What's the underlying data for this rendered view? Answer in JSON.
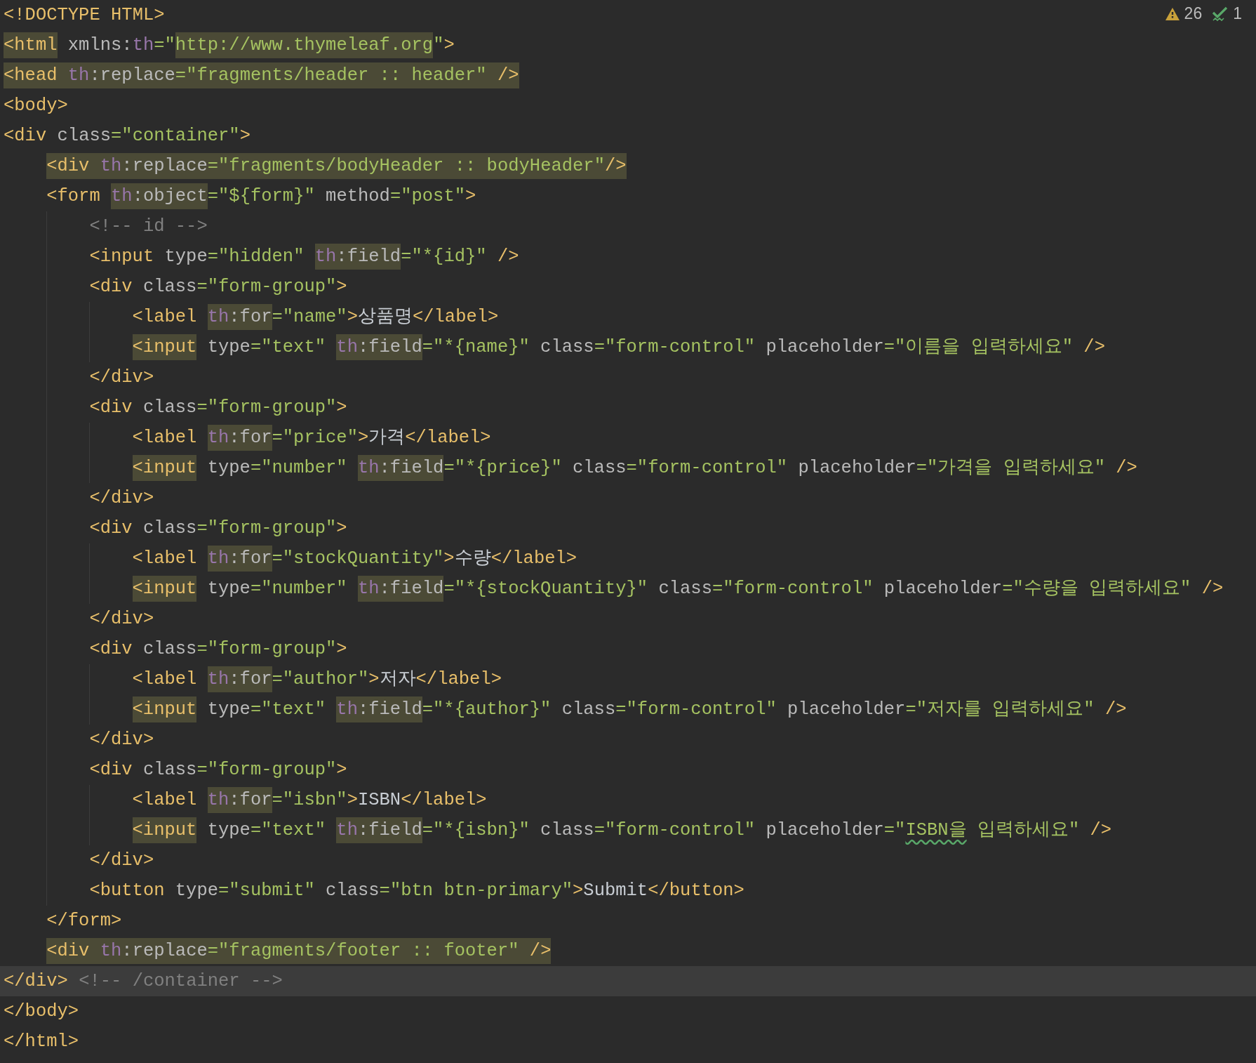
{
  "inspections": {
    "warnings": "26",
    "passed": "1"
  },
  "lines": [
    {
      "current": false,
      "segments": [
        {
          "text": "<!DOCTYPE HTML>",
          "kind": "tag",
          "highlighted": false
        }
      ]
    },
    {
      "current": false,
      "segments": [
        {
          "text": "<html",
          "kind": "tag",
          "highlighted": true
        },
        {
          "text": " xmlns:",
          "kind": "attribute",
          "highlighted": false
        },
        {
          "text": "th",
          "kind": "namespace",
          "highlighted": false
        },
        {
          "text": "=\"",
          "kind": "value",
          "highlighted": false
        },
        {
          "text": "http://www.thymeleaf.org",
          "kind": "value",
          "highlighted": true
        },
        {
          "text": "\"",
          "kind": "value",
          "highlighted": false
        },
        {
          "text": ">",
          "kind": "tag",
          "highlighted": false
        }
      ]
    },
    {
      "current": false,
      "segments": [
        {
          "text": "<head",
          "kind": "tag",
          "highlighted": true
        },
        {
          "text": " th",
          "kind": "namespace",
          "highlighted": true
        },
        {
          "text": ":replace",
          "kind": "attribute",
          "highlighted": true
        },
        {
          "text": "=\"fragments/header :: header\"",
          "kind": "value",
          "highlighted": true
        },
        {
          "text": " />",
          "kind": "tag",
          "highlighted": true
        }
      ]
    },
    {
      "current": false,
      "segments": [
        {
          "text": "<body>",
          "kind": "tag",
          "highlighted": false
        }
      ]
    },
    {
      "current": false,
      "segments": [
        {
          "text": "<div",
          "kind": "tag",
          "highlighted": false
        },
        {
          "text": " class",
          "kind": "attribute",
          "highlighted": false
        },
        {
          "text": "=\"container\"",
          "kind": "value",
          "highlighted": false
        },
        {
          "text": ">",
          "kind": "tag",
          "highlighted": false
        }
      ],
      "children": [
        {
          "current": false,
          "segments": [
            {
              "text": "<div",
              "kind": "tag",
              "highlighted": true
            },
            {
              "text": " th",
              "kind": "namespace",
              "highlighted": true
            },
            {
              "text": ":replace",
              "kind": "attribute",
              "highlighted": true
            },
            {
              "text": "=\"fragments/bodyHeader :: bodyHeader\"",
              "kind": "value",
              "highlighted": true
            },
            {
              "text": "/>",
              "kind": "tag",
              "highlighted": true
            }
          ]
        },
        {
          "current": false,
          "segments": [
            {
              "text": "<form ",
              "kind": "tag",
              "highlighted": false
            },
            {
              "text": "th",
              "kind": "namespace",
              "highlighted": true
            },
            {
              "text": ":object",
              "kind": "attribute",
              "highlighted": true
            },
            {
              "text": "=\"${form}\"",
              "kind": "value",
              "highlighted": false
            },
            {
              "text": " method",
              "kind": "attribute",
              "highlighted": false
            },
            {
              "text": "=\"post\"",
              "kind": "value",
              "highlighted": false
            },
            {
              "text": ">",
              "kind": "tag",
              "highlighted": false
            }
          ],
          "children": [
            {
              "current": false,
              "segments": [
                {
                  "text": "<!-- id -->",
                  "kind": "comment",
                  "highlighted": false
                }
              ]
            },
            {
              "current": false,
              "segments": [
                {
                  "text": "<input",
                  "kind": "tag",
                  "highlighted": false
                },
                {
                  "text": " type",
                  "kind": "attribute",
                  "highlighted": false
                },
                {
                  "text": "=\"hidden\" ",
                  "kind": "value",
                  "highlighted": false
                },
                {
                  "text": "th",
                  "kind": "namespace",
                  "highlighted": true
                },
                {
                  "text": ":field",
                  "kind": "attribute",
                  "highlighted": true
                },
                {
                  "text": "=\"*{id}\"",
                  "kind": "value",
                  "highlighted": false
                },
                {
                  "text": " />",
                  "kind": "tag",
                  "highlighted": false
                }
              ]
            },
            {
              "current": false,
              "segments": [
                {
                  "text": "<div",
                  "kind": "tag",
                  "highlighted": false
                },
                {
                  "text": " class",
                  "kind": "attribute",
                  "highlighted": false
                },
                {
                  "text": "=\"form-group\"",
                  "kind": "value",
                  "highlighted": false
                },
                {
                  "text": ">",
                  "kind": "tag",
                  "highlighted": false
                }
              ],
              "children": [
                {
                  "current": false,
                  "segments": [
                    {
                      "text": "<label ",
                      "kind": "tag",
                      "highlighted": false
                    },
                    {
                      "text": "th",
                      "kind": "namespace",
                      "highlighted": true
                    },
                    {
                      "text": ":for",
                      "kind": "attribute",
                      "highlighted": true
                    },
                    {
                      "text": "=\"name\"",
                      "kind": "value",
                      "highlighted": false
                    },
                    {
                      "text": ">",
                      "kind": "tag",
                      "highlighted": false
                    },
                    {
                      "text": "상품명",
                      "kind": "text",
                      "highlighted": false
                    },
                    {
                      "text": "</label>",
                      "kind": "tag",
                      "highlighted": false
                    }
                  ]
                },
                {
                  "current": false,
                  "segments": [
                    {
                      "text": "<input",
                      "kind": "tag",
                      "highlighted": true
                    },
                    {
                      "text": " type",
                      "kind": "attribute",
                      "highlighted": false
                    },
                    {
                      "text": "=\"text\" ",
                      "kind": "value",
                      "highlighted": false
                    },
                    {
                      "text": "th",
                      "kind": "namespace",
                      "highlighted": true
                    },
                    {
                      "text": ":field",
                      "kind": "attribute",
                      "highlighted": true
                    },
                    {
                      "text": "=\"*{name}\"",
                      "kind": "value",
                      "highlighted": false
                    },
                    {
                      "text": " class",
                      "kind": "attribute",
                      "highlighted": false
                    },
                    {
                      "text": "=\"form-control\"",
                      "kind": "value",
                      "highlighted": false
                    },
                    {
                      "text": " placeholder",
                      "kind": "attribute",
                      "highlighted": false
                    },
                    {
                      "text": "=\"이름을 입력하세요\"",
                      "kind": "value",
                      "highlighted": false
                    },
                    {
                      "text": " />",
                      "kind": "tag",
                      "highlighted": false
                    }
                  ]
                }
              ]
            },
            {
              "current": false,
              "segments": [
                {
                  "text": "</div>",
                  "kind": "tag",
                  "highlighted": false
                }
              ]
            },
            {
              "current": false,
              "segments": [
                {
                  "text": "<div",
                  "kind": "tag",
                  "highlighted": false
                },
                {
                  "text": " class",
                  "kind": "attribute",
                  "highlighted": false
                },
                {
                  "text": "=\"form-group\"",
                  "kind": "value",
                  "highlighted": false
                },
                {
                  "text": ">",
                  "kind": "tag",
                  "highlighted": false
                }
              ],
              "children": [
                {
                  "current": false,
                  "segments": [
                    {
                      "text": "<label ",
                      "kind": "tag",
                      "highlighted": false
                    },
                    {
                      "text": "th",
                      "kind": "namespace",
                      "highlighted": true
                    },
                    {
                      "text": ":for",
                      "kind": "attribute",
                      "highlighted": true
                    },
                    {
                      "text": "=\"price\"",
                      "kind": "value",
                      "highlighted": false
                    },
                    {
                      "text": ">",
                      "kind": "tag",
                      "highlighted": false
                    },
                    {
                      "text": "가격",
                      "kind": "text",
                      "highlighted": false
                    },
                    {
                      "text": "</label>",
                      "kind": "tag",
                      "highlighted": false
                    }
                  ]
                },
                {
                  "current": false,
                  "segments": [
                    {
                      "text": "<input",
                      "kind": "tag",
                      "highlighted": true
                    },
                    {
                      "text": " type",
                      "kind": "attribute",
                      "highlighted": false
                    },
                    {
                      "text": "=\"number\" ",
                      "kind": "value",
                      "highlighted": false
                    },
                    {
                      "text": "th",
                      "kind": "namespace",
                      "highlighted": true
                    },
                    {
                      "text": ":field",
                      "kind": "attribute",
                      "highlighted": true
                    },
                    {
                      "text": "=\"*{price}\"",
                      "kind": "value",
                      "highlighted": false
                    },
                    {
                      "text": " class",
                      "kind": "attribute",
                      "highlighted": false
                    },
                    {
                      "text": "=\"form-control\"",
                      "kind": "value",
                      "highlighted": false
                    },
                    {
                      "text": " placeholder",
                      "kind": "attribute",
                      "highlighted": false
                    },
                    {
                      "text": "=\"가격을 입력하세요\"",
                      "kind": "value",
                      "highlighted": false
                    },
                    {
                      "text": " />",
                      "kind": "tag",
                      "highlighted": false
                    }
                  ]
                }
              ]
            },
            {
              "current": false,
              "segments": [
                {
                  "text": "</div>",
                  "kind": "tag",
                  "highlighted": false
                }
              ]
            },
            {
              "current": false,
              "segments": [
                {
                  "text": "<div",
                  "kind": "tag",
                  "highlighted": false
                },
                {
                  "text": " class",
                  "kind": "attribute",
                  "highlighted": false
                },
                {
                  "text": "=\"form-group\"",
                  "kind": "value",
                  "highlighted": false
                },
                {
                  "text": ">",
                  "kind": "tag",
                  "highlighted": false
                }
              ],
              "children": [
                {
                  "current": false,
                  "segments": [
                    {
                      "text": "<label ",
                      "kind": "tag",
                      "highlighted": false
                    },
                    {
                      "text": "th",
                      "kind": "namespace",
                      "highlighted": true
                    },
                    {
                      "text": ":for",
                      "kind": "attribute",
                      "highlighted": true
                    },
                    {
                      "text": "=\"stockQuantity\"",
                      "kind": "value",
                      "highlighted": false
                    },
                    {
                      "text": ">",
                      "kind": "tag",
                      "highlighted": false
                    },
                    {
                      "text": "수량",
                      "kind": "text",
                      "highlighted": false
                    },
                    {
                      "text": "</label>",
                      "kind": "tag",
                      "highlighted": false
                    }
                  ]
                },
                {
                  "current": false,
                  "segments": [
                    {
                      "text": "<input",
                      "kind": "tag",
                      "highlighted": true
                    },
                    {
                      "text": " type",
                      "kind": "attribute",
                      "highlighted": false
                    },
                    {
                      "text": "=\"number\" ",
                      "kind": "value",
                      "highlighted": false
                    },
                    {
                      "text": "th",
                      "kind": "namespace",
                      "highlighted": true
                    },
                    {
                      "text": ":field",
                      "kind": "attribute",
                      "highlighted": true
                    },
                    {
                      "text": "=\"*{stockQuantity}\"",
                      "kind": "value",
                      "highlighted": false
                    },
                    {
                      "text": " class",
                      "kind": "attribute",
                      "highlighted": false
                    },
                    {
                      "text": "=\"form-control\"",
                      "kind": "value",
                      "highlighted": false
                    },
                    {
                      "text": " placeholder",
                      "kind": "attribute",
                      "highlighted": false
                    },
                    {
                      "text": "=\"수량을 입력하세요\"",
                      "kind": "value",
                      "highlighted": false
                    },
                    {
                      "text": " />",
                      "kind": "tag",
                      "highlighted": false
                    }
                  ]
                }
              ]
            },
            {
              "current": false,
              "segments": [
                {
                  "text": "</div>",
                  "kind": "tag",
                  "highlighted": false
                }
              ]
            },
            {
              "current": false,
              "segments": [
                {
                  "text": "<div",
                  "kind": "tag",
                  "highlighted": false
                },
                {
                  "text": " class",
                  "kind": "attribute",
                  "highlighted": false
                },
                {
                  "text": "=\"form-group\"",
                  "kind": "value",
                  "highlighted": false
                },
                {
                  "text": ">",
                  "kind": "tag",
                  "highlighted": false
                }
              ],
              "children": [
                {
                  "current": false,
                  "segments": [
                    {
                      "text": "<label ",
                      "kind": "tag",
                      "highlighted": false
                    },
                    {
                      "text": "th",
                      "kind": "namespace",
                      "highlighted": true
                    },
                    {
                      "text": ":for",
                      "kind": "attribute",
                      "highlighted": true
                    },
                    {
                      "text": "=\"author\"",
                      "kind": "value",
                      "highlighted": false
                    },
                    {
                      "text": ">",
                      "kind": "tag",
                      "highlighted": false
                    },
                    {
                      "text": "저자",
                      "kind": "text",
                      "highlighted": false
                    },
                    {
                      "text": "</label>",
                      "kind": "tag",
                      "highlighted": false
                    }
                  ]
                },
                {
                  "current": false,
                  "segments": [
                    {
                      "text": "<input",
                      "kind": "tag",
                      "highlighted": true
                    },
                    {
                      "text": " type",
                      "kind": "attribute",
                      "highlighted": false
                    },
                    {
                      "text": "=\"text\" ",
                      "kind": "value",
                      "highlighted": false
                    },
                    {
                      "text": "th",
                      "kind": "namespace",
                      "highlighted": true
                    },
                    {
                      "text": ":field",
                      "kind": "attribute",
                      "highlighted": true
                    },
                    {
                      "text": "=\"*{author}\"",
                      "kind": "value",
                      "highlighted": false
                    },
                    {
                      "text": " class",
                      "kind": "attribute",
                      "highlighted": false
                    },
                    {
                      "text": "=\"form-control\"",
                      "kind": "value",
                      "highlighted": false
                    },
                    {
                      "text": " placeholder",
                      "kind": "attribute",
                      "highlighted": false
                    },
                    {
                      "text": "=\"저자를 입력하세요\"",
                      "kind": "value",
                      "highlighted": false
                    },
                    {
                      "text": " />",
                      "kind": "tag",
                      "highlighted": false
                    }
                  ]
                }
              ]
            },
            {
              "current": false,
              "segments": [
                {
                  "text": "</div>",
                  "kind": "tag",
                  "highlighted": false
                }
              ]
            },
            {
              "current": false,
              "segments": [
                {
                  "text": "<div",
                  "kind": "tag",
                  "highlighted": false
                },
                {
                  "text": " class",
                  "kind": "attribute",
                  "highlighted": false
                },
                {
                  "text": "=\"form-group\"",
                  "kind": "value",
                  "highlighted": false
                },
                {
                  "text": ">",
                  "kind": "tag",
                  "highlighted": false
                }
              ],
              "children": [
                {
                  "current": false,
                  "segments": [
                    {
                      "text": "<label ",
                      "kind": "tag",
                      "highlighted": false
                    },
                    {
                      "text": "th",
                      "kind": "namespace",
                      "highlighted": true
                    },
                    {
                      "text": ":for",
                      "kind": "attribute",
                      "highlighted": true
                    },
                    {
                      "text": "=\"isbn\"",
                      "kind": "value",
                      "highlighted": false
                    },
                    {
                      "text": ">",
                      "kind": "tag",
                      "highlighted": false
                    },
                    {
                      "text": "ISBN",
                      "kind": "text",
                      "highlighted": false
                    },
                    {
                      "text": "</label>",
                      "kind": "tag",
                      "highlighted": false
                    }
                  ]
                },
                {
                  "current": false,
                  "segments": [
                    {
                      "text": "<input",
                      "kind": "tag",
                      "highlighted": true
                    },
                    {
                      "text": " type",
                      "kind": "attribute",
                      "highlighted": false
                    },
                    {
                      "text": "=\"text\" ",
                      "kind": "value",
                      "highlighted": false
                    },
                    {
                      "text": "th",
                      "kind": "namespace",
                      "highlighted": true
                    },
                    {
                      "text": ":field",
                      "kind": "attribute",
                      "highlighted": true
                    },
                    {
                      "text": "=\"*{isbn}\"",
                      "kind": "value",
                      "highlighted": false
                    },
                    {
                      "text": " class",
                      "kind": "attribute",
                      "highlighted": false
                    },
                    {
                      "text": "=\"form-control\"",
                      "kind": "value",
                      "highlighted": false
                    },
                    {
                      "text": " placeholder",
                      "kind": "attribute",
                      "highlighted": false
                    },
                    {
                      "text": "=\"",
                      "kind": "value",
                      "highlighted": false
                    },
                    {
                      "text": "ISBN을",
                      "kind": "misspelled",
                      "highlighted": false
                    },
                    {
                      "text": " 입력하세요\"",
                      "kind": "value",
                      "highlighted": false
                    },
                    {
                      "text": " />",
                      "kind": "tag",
                      "highlighted": false
                    }
                  ]
                }
              ]
            },
            {
              "current": false,
              "segments": [
                {
                  "text": "</div>",
                  "kind": "tag",
                  "highlighted": false
                }
              ]
            },
            {
              "current": false,
              "segments": [
                {
                  "text": "<button",
                  "kind": "tag",
                  "highlighted": false
                },
                {
                  "text": " type",
                  "kind": "attribute",
                  "highlighted": false
                },
                {
                  "text": "=\"submit\"",
                  "kind": "value",
                  "highlighted": false
                },
                {
                  "text": " class",
                  "kind": "attribute",
                  "highlighted": false
                },
                {
                  "text": "=\"btn btn-primary\"",
                  "kind": "value",
                  "highlighted": false
                },
                {
                  "text": ">",
                  "kind": "tag",
                  "highlighted": false
                },
                {
                  "text": "Submit",
                  "kind": "text",
                  "highlighted": false
                },
                {
                  "text": "</button>",
                  "kind": "tag",
                  "highlighted": false
                }
              ]
            }
          ]
        },
        {
          "current": false,
          "segments": [
            {
              "text": "</form>",
              "kind": "tag",
              "highlighted": false
            }
          ]
        },
        {
          "current": false,
          "segments": [
            {
              "text": "<div",
              "kind": "tag",
              "highlighted": true
            },
            {
              "text": " th",
              "kind": "namespace",
              "highlighted": true
            },
            {
              "text": ":replace",
              "kind": "attribute",
              "highlighted": true
            },
            {
              "text": "=\"fragments/footer :: footer\"",
              "kind": "value",
              "highlighted": true
            },
            {
              "text": " />",
              "kind": "tag",
              "highlighted": true
            }
          ]
        }
      ]
    },
    {
      "current": true,
      "segments": [
        {
          "text": "</div>",
          "kind": "tag",
          "highlighted": false
        },
        {
          "text": " <!-- /container -->",
          "kind": "comment",
          "highlighted": false
        }
      ]
    },
    {
      "current": false,
      "segments": [
        {
          "text": "</body>",
          "kind": "tag",
          "highlighted": false
        }
      ]
    },
    {
      "current": false,
      "segments": [
        {
          "text": "</html>",
          "kind": "tag",
          "highlighted": false
        }
      ]
    }
  ]
}
